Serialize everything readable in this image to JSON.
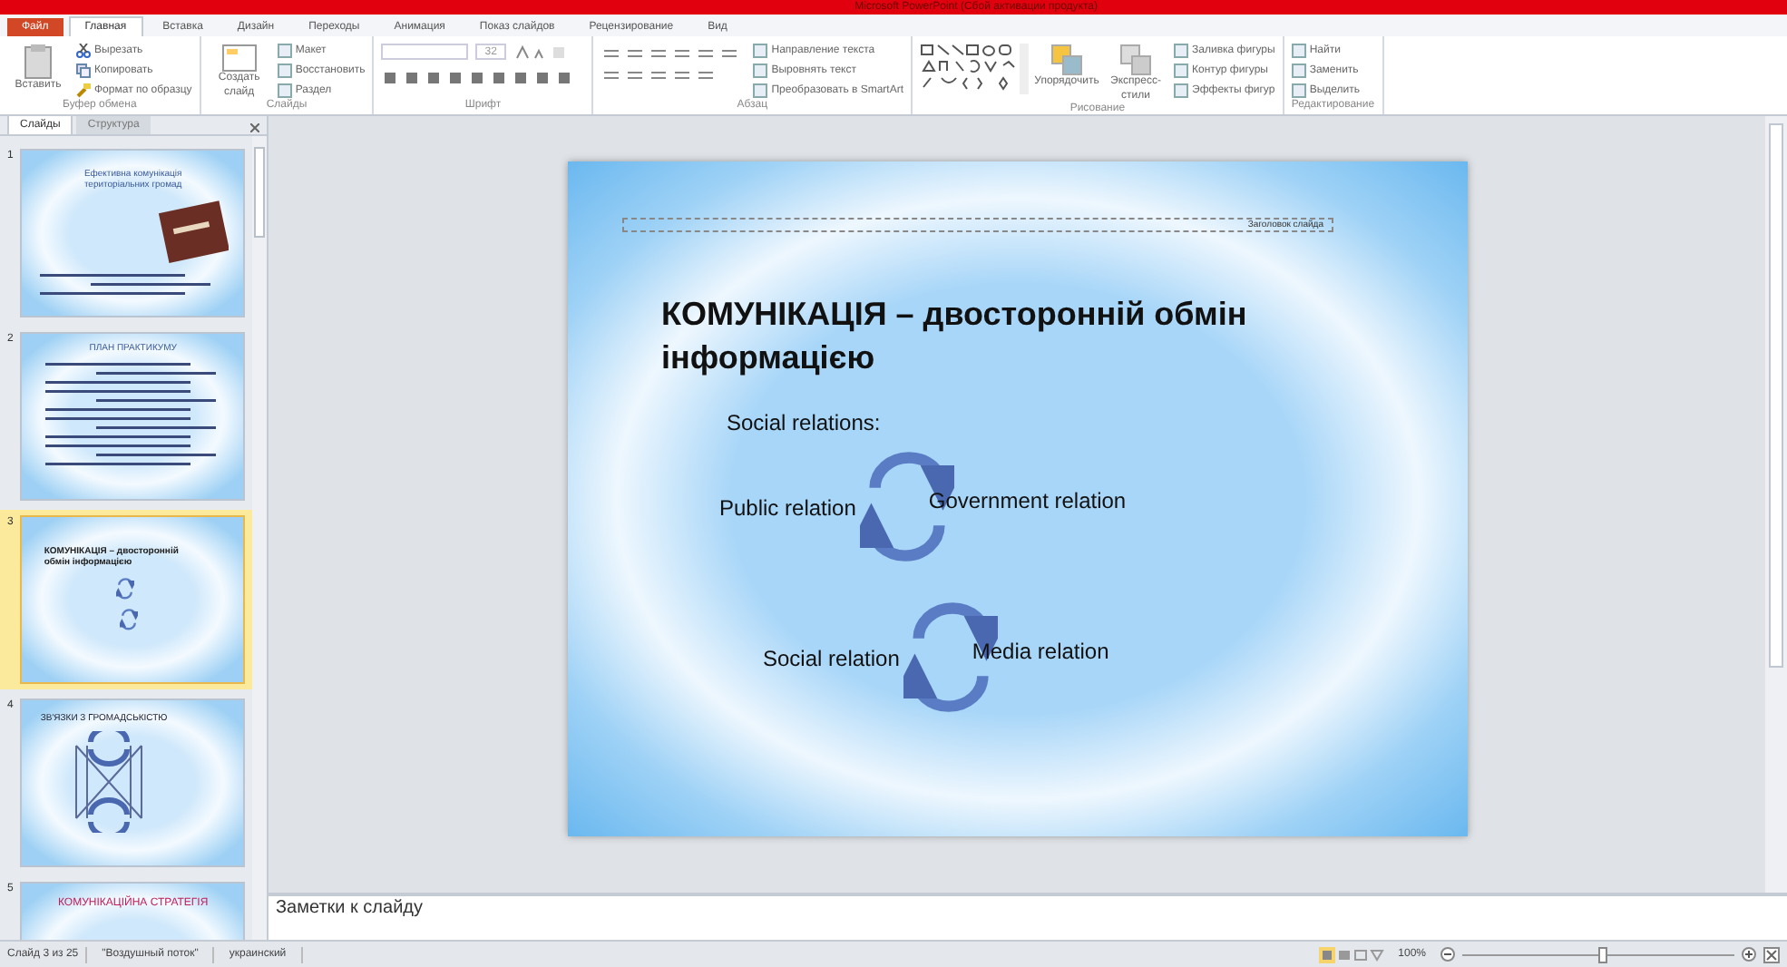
{
  "window": {
    "title": "Microsoft PowerPoint (Сбой активации продукта)"
  },
  "ribbon_tabs": [
    {
      "label": "Файл",
      "kind": "file"
    },
    {
      "label": "Главная",
      "kind": "tab",
      "selected": true
    },
    {
      "label": "Вставка",
      "kind": "tab",
      "selected": false
    },
    {
      "label": "Дизайн",
      "kind": "tab",
      "selected": false
    },
    {
      "label": "Переходы",
      "kind": "tab",
      "selected": false
    },
    {
      "label": "Анимация",
      "kind": "tab",
      "selected": false
    },
    {
      "label": "Показ слайдов",
      "kind": "tab",
      "selected": false
    },
    {
      "label": "Рецензирование",
      "kind": "tab",
      "selected": false
    },
    {
      "label": "Вид",
      "kind": "tab",
      "selected": false
    }
  ],
  "ribbon_groups": [
    {
      "label": "Буфер обмена",
      "items": [
        {
          "kind": "large",
          "label": "Вставить"
        },
        {
          "kind": "small",
          "label": "Вырезать"
        },
        {
          "kind": "small",
          "label": "Копировать"
        },
        {
          "kind": "small",
          "label": "Формат по образцу"
        }
      ]
    },
    {
      "label": "Слайды",
      "items": [
        {
          "kind": "large",
          "label": "Создать слайд"
        },
        {
          "kind": "small",
          "label": "Макет"
        },
        {
          "kind": "small",
          "label": "Восстановить"
        },
        {
          "kind": "small",
          "label": "Раздел"
        }
      ]
    },
    {
      "label": "Шрифт",
      "items": [
        {
          "kind": "font",
          "value": "32"
        }
      ]
    },
    {
      "label": "Абзац",
      "items": [
        {
          "kind": "para"
        },
        {
          "kind": "small",
          "label": "Направление текста"
        },
        {
          "kind": "small",
          "label": "Выровнять текст"
        },
        {
          "kind": "small",
          "label": "Преобразовать в SmartArt"
        }
      ]
    },
    {
      "label": "Рисование",
      "items": [
        {
          "kind": "shapes"
        },
        {
          "kind": "large",
          "label": "Упорядочить"
        },
        {
          "kind": "large",
          "label": "Экспресс-стили"
        },
        {
          "kind": "small",
          "label": "Заливка фигуры"
        },
        {
          "kind": "small",
          "label": "Контур фигуры"
        },
        {
          "kind": "small",
          "label": "Эффекты фигур"
        }
      ]
    },
    {
      "label": "Редактирование",
      "items": [
        {
          "kind": "small",
          "label": "Найти"
        },
        {
          "kind": "small",
          "label": "Заменить"
        },
        {
          "kind": "small",
          "label": "Выделить"
        }
      ]
    }
  ],
  "panel_tabs": [
    {
      "label": "Слайды",
      "selected": true
    },
    {
      "label": "Структура",
      "selected": false
    }
  ],
  "thumbnails": [
    {
      "number": "1",
      "kind": "title",
      "title": "Ефективна комунікація територіальних громад",
      "selected": false
    },
    {
      "number": "2",
      "kind": "list",
      "title": "ПЛАН ПРАКТИКУМУ",
      "selected": false
    },
    {
      "number": "3",
      "kind": "cycle",
      "title": "КОМУНІКАЦІЯ – двосторонній обмін інформацією",
      "selected": true
    },
    {
      "number": "4",
      "kind": "cross",
      "title": "ЗВ'ЯЗКИ З ГРОМАДСЬКІСТЮ",
      "selected": false
    },
    {
      "number": "5",
      "kind": "bullet",
      "title": "КОМУНІКАЦІЙНА СТРАТЕГІЯ",
      "selected": false
    }
  ],
  "slide": {
    "placeholder_label": "Заголовок слайда",
    "title": "КОМУНІКАЦІЯ – двосторонній обмін інформацією",
    "subtitle": "Social relations:",
    "cycles": [
      {
        "left": "Public relation",
        "right": "Government relation"
      },
      {
        "left": "Social relation",
        "right": "Media relation"
      }
    ]
  },
  "notes": {
    "placeholder": "Заметки к слайду"
  },
  "status_bar": {
    "slide_counter": "Слайд 3 из 25",
    "theme": "\"Воздушный поток\"",
    "language": "украинский",
    "zoom": {
      "label": "100%",
      "level": 0.5
    }
  }
}
